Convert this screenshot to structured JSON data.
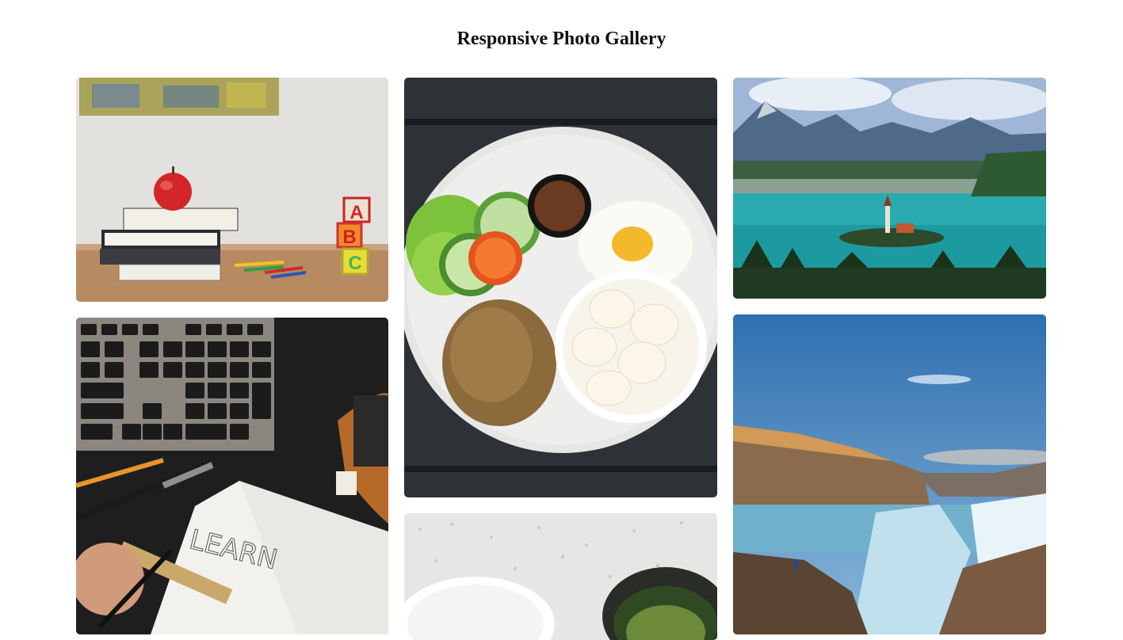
{
  "header": {
    "title": "Responsive Photo Gallery"
  },
  "gallery": {
    "photos": [
      {
        "subject": "apple-on-books-with-abc-blocks"
      },
      {
        "subject": "nasi-goreng-plate-with-crackers"
      },
      {
        "subject": "lake-island-church-mountains"
      },
      {
        "subject": "keyboard-notebook-learn-sketch"
      },
      {
        "subject": "canyon-waterfall-blue-sky"
      },
      {
        "subject": "bowls-on-speckled-countertop"
      }
    ]
  },
  "colors": {
    "background": "#ffffff",
    "title": "#111111"
  }
}
